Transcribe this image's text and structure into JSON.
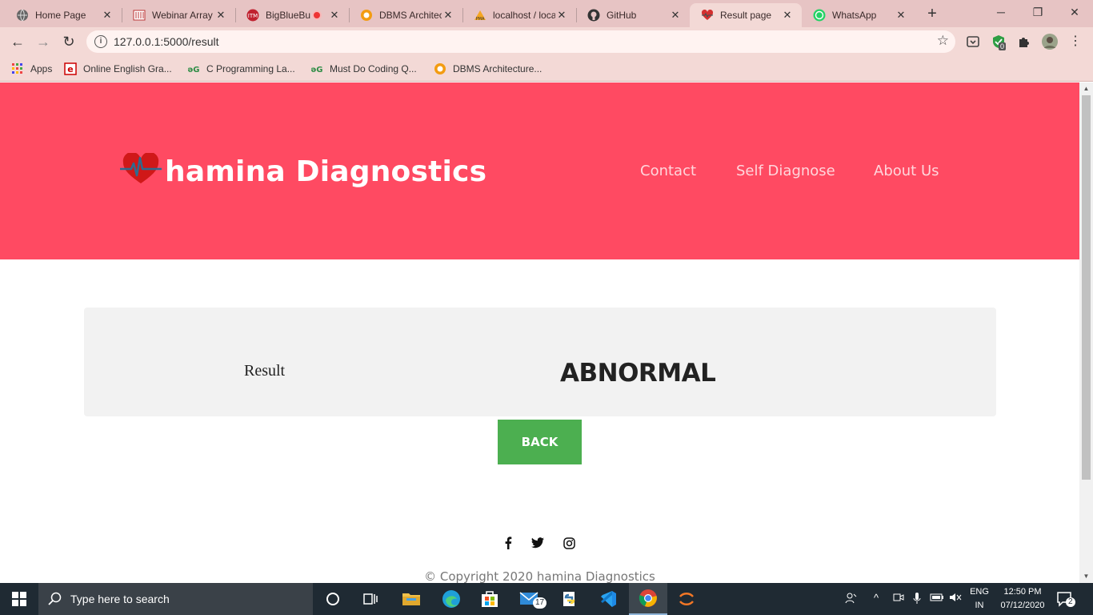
{
  "browser": {
    "tabs": [
      {
        "title": "Home Page",
        "icon": "globe-icon"
      },
      {
        "title": "Webinar Array",
        "icon": "webinar-icon"
      },
      {
        "title": "BigBlueBu",
        "icon": "bigbluebutton-icon"
      },
      {
        "title": "DBMS Architec",
        "icon": "dbms-icon"
      },
      {
        "title": "localhost / loca",
        "icon": "phpmyadmin-icon"
      },
      {
        "title": "GitHub",
        "icon": "github-icon"
      },
      {
        "title": "Result page",
        "icon": "heart-icon",
        "active": true
      },
      {
        "title": "WhatsApp",
        "icon": "whatsapp-icon"
      }
    ],
    "url": "127.0.0.1:5000/result",
    "extension_badge": "0",
    "bookmarks": [
      {
        "label": "Apps",
        "icon": "apps-grid-icon"
      },
      {
        "label": "Online English Gra...",
        "icon": "english-icon"
      },
      {
        "label": "C Programming La...",
        "icon": "geeks-icon"
      },
      {
        "label": "Must Do Coding Q...",
        "icon": "geeks-icon"
      },
      {
        "label": "DBMS Architecture...",
        "icon": "dbms-icon"
      }
    ]
  },
  "site": {
    "brand": "hamina Diagnostics",
    "nav": [
      "Contact",
      "Self Diagnose",
      "About Us"
    ],
    "accent_color": "#ff4a62",
    "result_label": "Result",
    "result_value": "ABNORMAL",
    "back_button": "BACK",
    "social_icons": [
      "facebook-icon",
      "twitter-icon",
      "instagram-icon"
    ],
    "copyright": "© Copyright 2020 hamina Diagnostics"
  },
  "taskbar": {
    "search_placeholder": "Type here to search",
    "mail_badge": "17",
    "lang_line1": "ENG",
    "lang_line2": "IN",
    "time": "12:50 PM",
    "date": "07/12/2020",
    "notification_count": "2"
  }
}
